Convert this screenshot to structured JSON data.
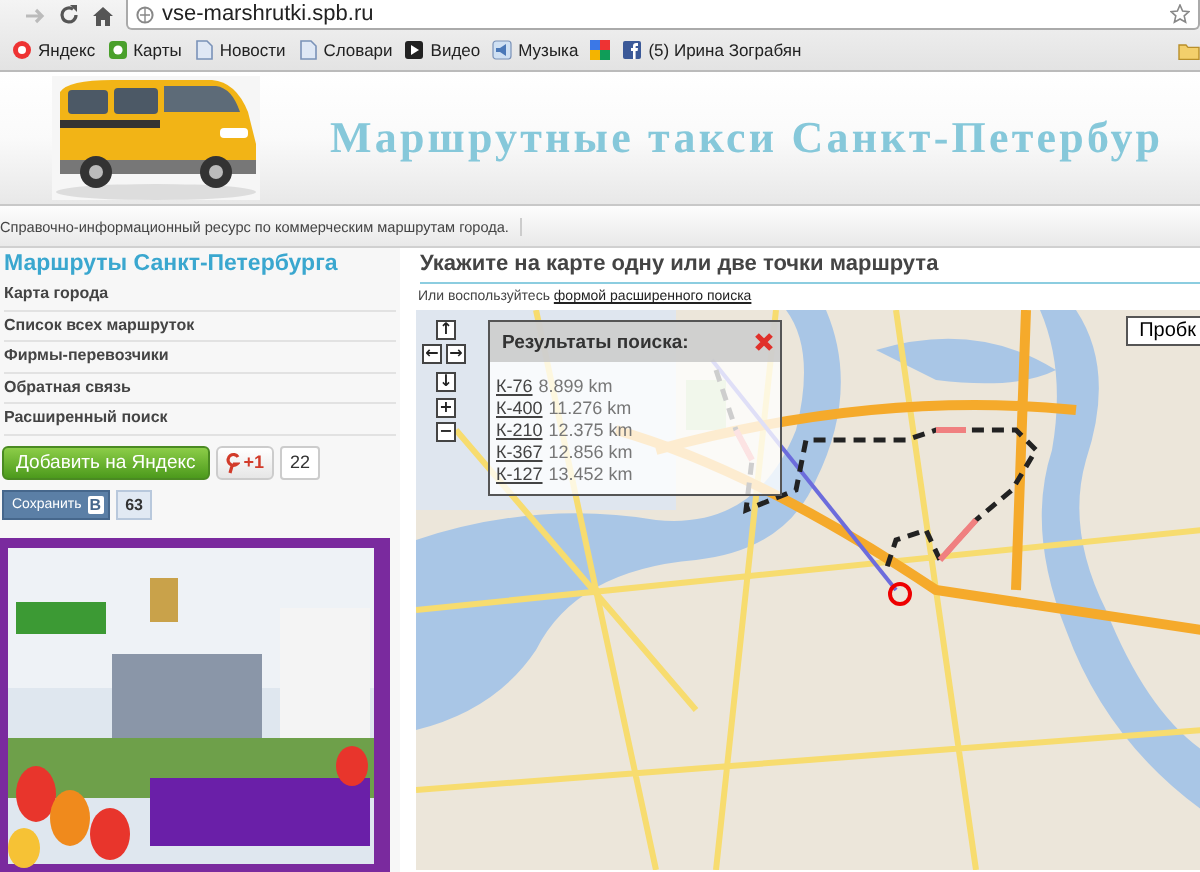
{
  "browser": {
    "url": "vse-marshrutki.spb.ru",
    "bookmarks": [
      {
        "label": "Яндекс",
        "kind": "plain"
      },
      {
        "label": "Карты",
        "kind": "maps"
      },
      {
        "label": "Новости",
        "kind": "page"
      },
      {
        "label": "Словари",
        "kind": "page"
      },
      {
        "label": "Видео",
        "kind": "video"
      },
      {
        "label": "Музыка",
        "kind": "music"
      },
      {
        "kind": "google"
      },
      {
        "label": "(5) Ирина Зограбян",
        "kind": "facebook"
      }
    ]
  },
  "header": {
    "title": "Маршрутные такси Санкт-Петербур",
    "tagline": "Справочно-информационный ресурс по коммерческим маршрутам города."
  },
  "sidebar": {
    "heading": "Маршруты Санкт-Петербурга",
    "items": [
      "Карта города",
      "Список всех маршруток",
      "Фирмы-перевозчики",
      "Обратная связь",
      "Расширенный поиск"
    ],
    "yandex_button": "Добавить на Яндекс",
    "plusone": {
      "label": "+1",
      "count": "22"
    },
    "vk": {
      "label": "Сохранить",
      "icon": "В",
      "count": "63"
    }
  },
  "main": {
    "heading": "Укажите на карте одну или две точки маршрута",
    "hint": "Или воспользуйтесь",
    "hint_link": "формой расширенного поиска",
    "map": {
      "controls": [
        "↑",
        "←",
        "→",
        "↓",
        "+",
        "−"
      ],
      "traffic_button": "Пробк",
      "results": {
        "title": "Результаты поиска:",
        "items": [
          {
            "route": "К-76",
            "distance": "8.899 km"
          },
          {
            "route": "К-400",
            "distance": "11.276 km"
          },
          {
            "route": "К-210",
            "distance": "12.375 km"
          },
          {
            "route": "К-367",
            "distance": "12.856 km"
          },
          {
            "route": "К-127",
            "distance": "13.452 km"
          }
        ]
      }
    }
  }
}
